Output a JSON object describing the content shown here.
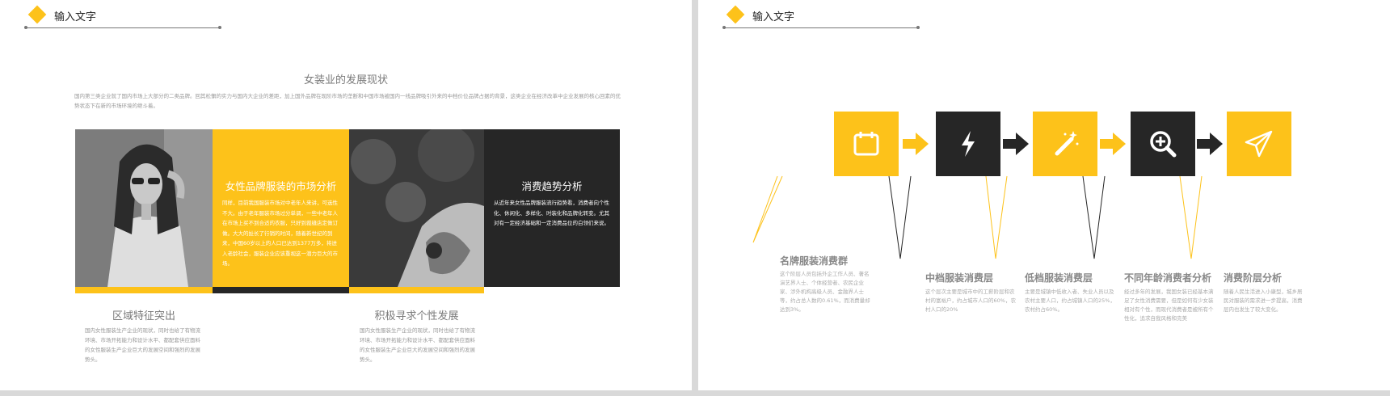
{
  "left": {
    "header_title": "输入文字",
    "intro": {
      "title": "女装业的发展现状",
      "body": "国内第三类企业就了国内市场上大部分的二类品牌。回其松懈的实力与国内大企业的差距，加上国外品牌在现阶市场的垄断和中国市场被国内一线品牌吸引外来的中档价位品牌占据的背景，这类企业在经济改革中企业发展的核心回素的优势状态下在新的市场环境的继斗着。"
    },
    "cells": [
      {
        "kind": "photo",
        "name": "woman-sunglasses"
      },
      {
        "kind": "text",
        "title": "女性品牌服装的市场分析",
        "body": "同样，目前我国服装市场对中老年人来讲，可选性不大。由于老年服装市场过分单调，一些中老年人在市场上买不到合适的衣服，只好到裁缝店定做订做。大大的扯长了行销的时间，随着新世纪的到来，中国60岁以上的人口已达到1377万多，将进入老龄社会，服装企业应该重视这一潜力巨大的市场。"
      },
      {
        "kind": "photo",
        "name": "shopping-bag"
      },
      {
        "kind": "text",
        "title": "消费趋势分析",
        "body": "从近年来女性品牌服装流行趋势看，消费者向个性化、休闲化、多样化、时装化和品牌化转变。尤其对有一定经济基础和一定消费品位的白领们来说。"
      }
    ],
    "bottom": [
      {
        "title": "区域特征突出",
        "body": "国内女性服装生产企业的现状，同时也给了有物流环境、市场开拓能力和设计水平、都配套供应面料的女性服装生产企业巨大的发展空间和强烈的发展势头。"
      },
      {
        "title": "积极寻求个性发展",
        "body": "国内女性服装生产企业的现状，同时也给了有物流环境、市场开拓能力和设计水平、都配套供应面料的女性服装生产企业巨大的发展空间和强烈的发展势头。"
      }
    ]
  },
  "right": {
    "header_title": "输入文字",
    "steps": [
      {
        "icon": "calendar-icon",
        "title": "名牌服装消费群",
        "body": "这个阶层人员包括外企工作人员、著名演艺界人士、个体经营者、农民企业家、涉外机构高级人员、金融界人士等，约占总人数的0.61%，而消费量却达到3%。"
      },
      {
        "icon": "lightning-icon",
        "title": "中档服装消费层",
        "body": "这个层次主要是城市中的工薪阶层和农村的富裕户，约占城市人口的60%，农村人口的20%"
      },
      {
        "icon": "magic-wand-icon",
        "title": "低档服装消费层",
        "body": "主要是城镇中低收入者、失业人员以及农村主要人口，约占城镇人口的25%，农村约占60%。"
      },
      {
        "icon": "zoom-in-icon",
        "title": "不同年龄消费者分析",
        "body": "经过多年的发展，我国女装已经基本满足了女性消费需要，但是如何有少女装相对有个性，而现代消费者是被所有个性化，追求自我风格和完美"
      },
      {
        "icon": "paper-plane-icon",
        "title": "消费阶层分析",
        "body": "随着人民生活进入小康型，城乡居民对服装的需求进一步提高，消费层内也发生了较大变化。"
      }
    ]
  },
  "colors": {
    "accent": "#fdc21a",
    "dark": "#262626"
  }
}
